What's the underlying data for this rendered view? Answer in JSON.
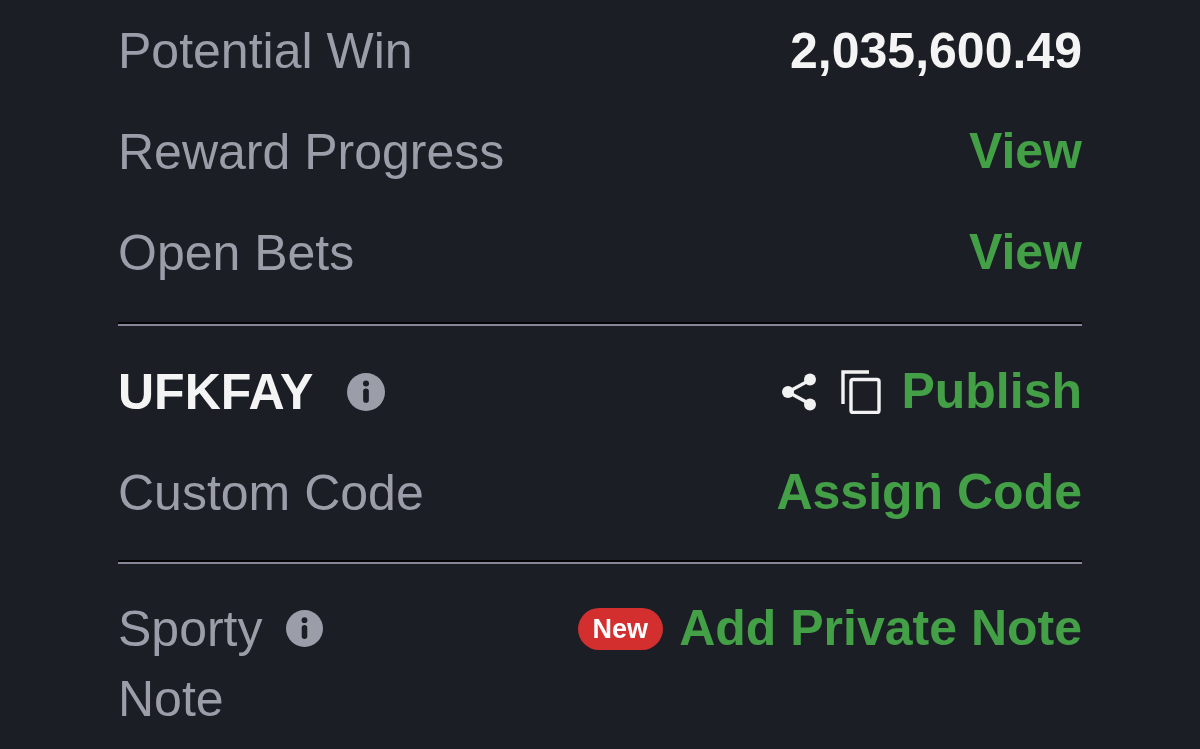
{
  "sections": [
    {
      "rows": [
        {
          "kind": "value",
          "label": "Potential Win",
          "value": "2,035,600.49"
        },
        {
          "kind": "link",
          "label": "Reward Progress",
          "link": "View"
        },
        {
          "kind": "link",
          "label": "Open Bets",
          "link": "View"
        }
      ]
    },
    {
      "rows": [
        {
          "kind": "code",
          "code": "UFKFAY",
          "link": "Publish"
        },
        {
          "kind": "link",
          "label": "Custom Code",
          "link": "Assign Code"
        }
      ]
    },
    {
      "rows": [
        {
          "kind": "note",
          "label": "Sporty Note",
          "badge": "New",
          "link": "Add Private Note"
        }
      ]
    }
  ]
}
